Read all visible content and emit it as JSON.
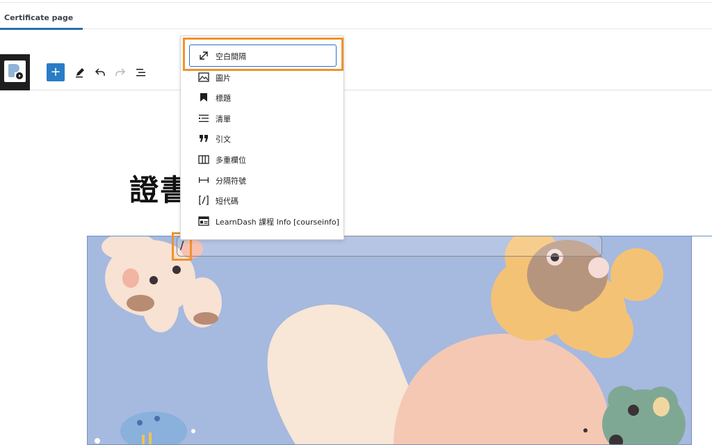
{
  "tab": {
    "label": "Certificate page"
  },
  "toolbar": {
    "add_label": "+",
    "icons": [
      "pencil-icon",
      "undo-icon",
      "redo-icon",
      "list-view-icon"
    ]
  },
  "editor": {
    "heading_text": "證書"
  },
  "slash_input": {
    "value": "/"
  },
  "inserter": {
    "items": [
      {
        "label": "空白間隔",
        "icon": "resize-arrow-icon"
      },
      {
        "label": "圖片",
        "icon": "image-icon"
      },
      {
        "label": "標題",
        "icon": "bookmark-icon"
      },
      {
        "label": "清單",
        "icon": "list-icon"
      },
      {
        "label": "引文",
        "icon": "quote-icon"
      },
      {
        "label": "多重欄位",
        "icon": "columns-icon"
      },
      {
        "label": "分隔符號",
        "icon": "separator-icon"
      },
      {
        "label": "短代碼",
        "icon": "shortcode-icon"
      },
      {
        "label": "LearnDash 課程 Info [courseinfo]",
        "icon": "course-info-icon"
      }
    ]
  },
  "colors": {
    "accent": "#2a7cc7",
    "highlight": "#f0932b",
    "canvas_bg": "#a6b9df"
  }
}
